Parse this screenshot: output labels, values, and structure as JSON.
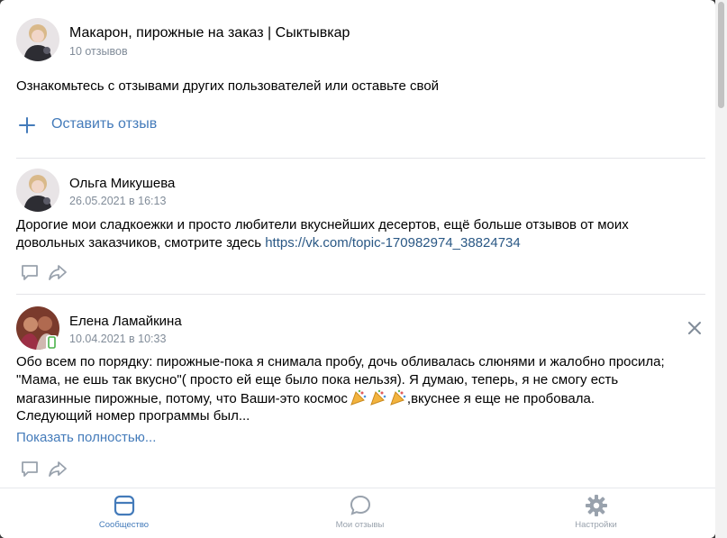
{
  "community": {
    "title": "Макарон, пирожные на заказ | Сыктывкар",
    "reviews_count": "10 отзывов"
  },
  "intro_text": "Ознакомьтесь с отзывами других пользователей или оставьте свой",
  "leave_review_label": "Оставить отзыв",
  "reviews": [
    {
      "author": "Ольга Микушева",
      "date": "26.05.2021 в 16:13",
      "text_lines": [
        "Дорогие мои сладкоежки и просто любители вкуснейших десертов, ещё больше отзывов от моих",
        "довольных заказчиков, смотрите здесь "
      ],
      "link": "https://vk.com/topic-170982974_38824734"
    },
    {
      "author": "Елена Ламайкина",
      "date": "10.04.2021 в 10:33",
      "text_lines": [
        "Обо всем по порядку: пирожные-пока я снимала пробу, дочь обливалась слюнями и жалобно просила;",
        "\"Мама, не ешь так вкусно\"( просто ей еще было пока нельзя). Я думаю, теперь, я не смогу есть",
        "магазинные пирожные, потому, что Ваши-это космос",
        ",вкуснее я еще не пробовала.",
        "Следующий номер программы был..."
      ],
      "show_more_label": "Показать полностью..."
    }
  ],
  "tabs": [
    {
      "label": "Сообщество",
      "icon": "community-icon",
      "active": true
    },
    {
      "label": "Мои отзывы",
      "icon": "chat-bubble-icon",
      "active": false
    },
    {
      "label": "Настройки",
      "icon": "gear-icon",
      "active": false
    }
  ],
  "colors": {
    "accent": "#447bba",
    "link": "#2a5885",
    "muted": "#818c99",
    "divider": "#e3e4e8"
  }
}
